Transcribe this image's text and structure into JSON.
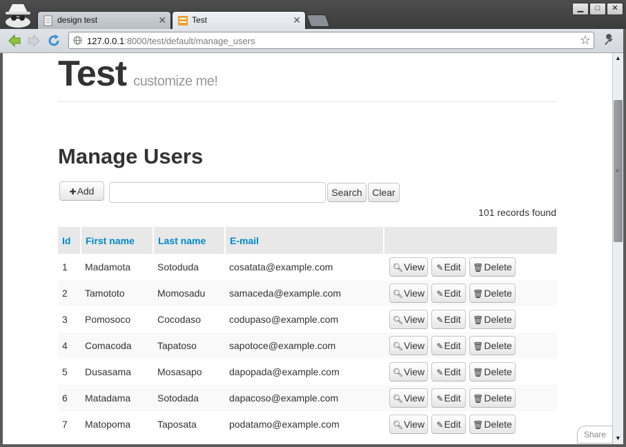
{
  "browser": {
    "tabs": [
      {
        "label": "design test"
      },
      {
        "label": "Test"
      }
    ],
    "url_host": "127.0.0.1",
    "url_path": ":8000/test/default/manage_users"
  },
  "header": {
    "brand": "Test",
    "tagline": "customize me!"
  },
  "main": {
    "title": "Manage Users",
    "add_label": "Add",
    "search_label": "Search",
    "clear_label": "Clear",
    "search_value": "",
    "records_found": "101 records found",
    "columns": [
      "Id",
      "First name",
      "Last name",
      "E-mail"
    ],
    "rows": [
      {
        "id": "1",
        "first": "Madamota",
        "last": "Sotoduda",
        "email": "cosatata@example.com"
      },
      {
        "id": "2",
        "first": "Tamototo",
        "last": "Momosadu",
        "email": "samaceda@example.com"
      },
      {
        "id": "3",
        "first": "Pomosoco",
        "last": "Cocodaso",
        "email": "codupaso@example.com"
      },
      {
        "id": "4",
        "first": "Comacoda",
        "last": "Tapatoso",
        "email": "sapotoce@example.com"
      },
      {
        "id": "5",
        "first": "Dusasama",
        "last": "Mosasapo",
        "email": "dapopada@example.com"
      },
      {
        "id": "6",
        "first": "Matadama",
        "last": "Sotodada",
        "email": "dapacoso@example.com"
      },
      {
        "id": "7",
        "first": "Matopoma",
        "last": "Taposata",
        "email": "podatamo@example.com"
      }
    ],
    "actions": {
      "view": "View",
      "edit": "Edit",
      "delete": "Delete"
    }
  },
  "share_label": "Share",
  "colors": {
    "link": "#0088cc",
    "header_bg": "#e8e8e8",
    "text": "#333333"
  }
}
